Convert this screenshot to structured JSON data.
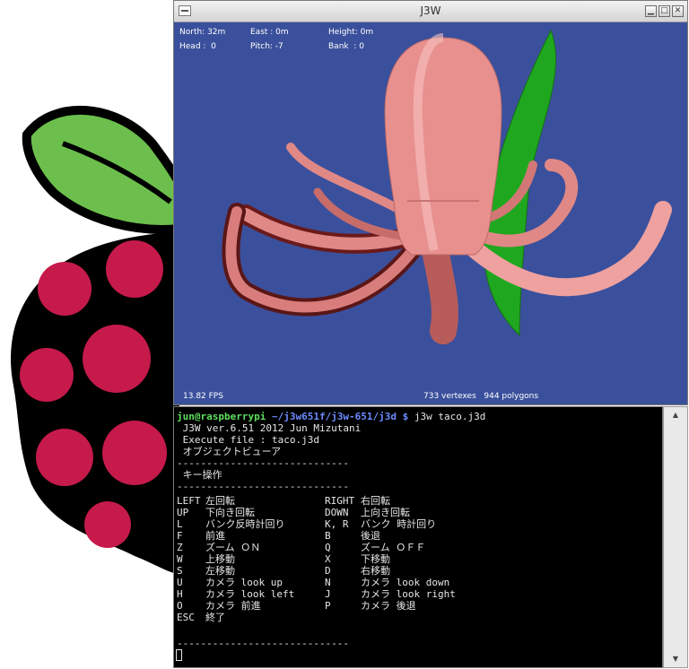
{
  "window": {
    "title": "J3W",
    "min_glyph": "▁",
    "max_glyph": "□",
    "close_glyph": "✕"
  },
  "hud": {
    "north": "North: 32m",
    "east": "East : 0m",
    "height": "Height: 0m",
    "head": "Head :  0",
    "pitch": "Pitch: -7",
    "bank": "Bank  : 0",
    "fps": "13.82 FPS",
    "stats": "733 vertexes   944 polygons"
  },
  "terminal": {
    "prompt_user": "jun@raspberrypi",
    "prompt_path": " ~/j3w651f/j3w-651/j3d $",
    "command": " j3w taco.j3d",
    "lines": [
      " J3W ver.6.51 2012 Jun Mizutani",
      " Execute file : taco.j3d",
      " オブジェクトビューア",
      "-----------------------------",
      " キー操作",
      "-----------------------------"
    ],
    "keys": [
      {
        "k1": "LEFT",
        "d1": "左回転",
        "k2": "RIGHT",
        "d2": "右回転"
      },
      {
        "k1": "UP",
        "d1": "下向き回転",
        "k2": "DOWN",
        "d2": "上向き回転"
      },
      {
        "k1": "L",
        "d1": "バンク反時計回り",
        "k2": "K, R",
        "d2": "バンク 時計回り"
      },
      {
        "k1": "F",
        "d1": "前進",
        "k2": "B",
        "d2": "後退"
      },
      {
        "k1": "Z",
        "d1": "ズーム ＯＮ",
        "k2": "Q",
        "d2": "ズーム ＯＦＦ"
      },
      {
        "k1": "W",
        "d1": "上移動",
        "k2": "X",
        "d2": "下移動"
      },
      {
        "k1": "S",
        "d1": "左移動",
        "k2": "D",
        "d2": "右移動"
      },
      {
        "k1": "U",
        "d1": "カメラ look up",
        "k2": "N",
        "d2": "カメラ look down"
      },
      {
        "k1": "H",
        "d1": "カメラ look left",
        "k2": "J",
        "d2": "カメラ look right"
      },
      {
        "k1": "O",
        "d1": "カメラ 前進",
        "k2": "P",
        "d2": "カメラ 後退"
      },
      {
        "k1": "ESC",
        "d1": "終了",
        "k2": "",
        "d2": ""
      }
    ],
    "footer": "-----------------------------",
    "scroll_up": "▲",
    "scroll_down": "▼"
  },
  "colors": {
    "viewport_bg": "#3b509c",
    "octopus": "#e8908e",
    "leaf": "#1fa81f",
    "prompt_user": "#5ee05e",
    "prompt_path": "#6c8cff"
  }
}
